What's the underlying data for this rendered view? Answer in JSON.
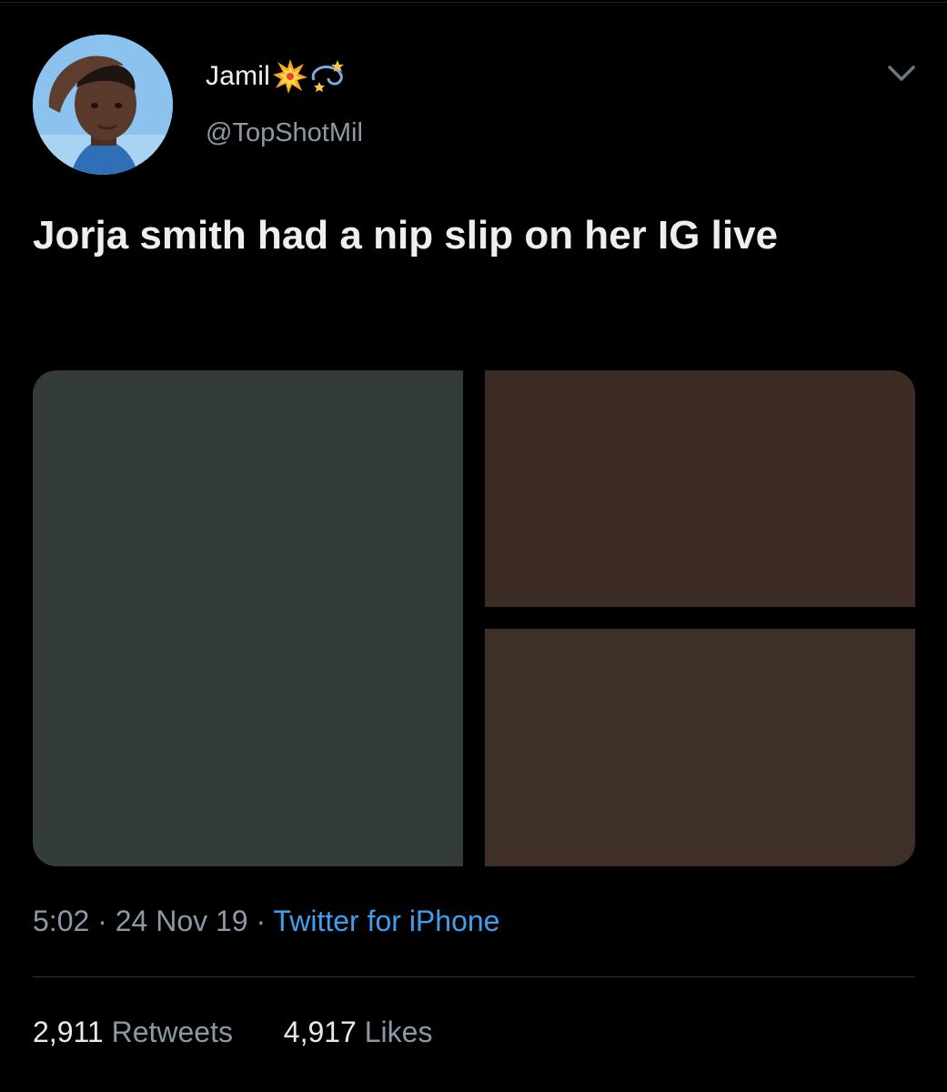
{
  "tweet": {
    "author": {
      "display_name": "Jamil",
      "name_emojis": [
        "collision-icon",
        "dizzy-star-icon"
      ],
      "handle": "@TopShotMil"
    },
    "text": "Jorja smith had a nip slip on her IG live",
    "media": {
      "count": 3,
      "colors": [
        "#343c3a",
        "#3d2b25",
        "#3e3029"
      ]
    },
    "time": "5:02",
    "date": "24 Nov 19",
    "separator": "·",
    "source": "Twitter for iPhone",
    "stats": {
      "retweets_count": "2,911",
      "retweets_label": "Retweets",
      "likes_count": "4,917",
      "likes_label": "Likes"
    }
  },
  "colors": {
    "background": "#000000",
    "text": "#e7e9ea",
    "secondary_text": "#8b98a5",
    "link": "#3e9ff0",
    "divider": "#2f3336"
  },
  "icons": {
    "menu": "chevron-down-icon"
  }
}
